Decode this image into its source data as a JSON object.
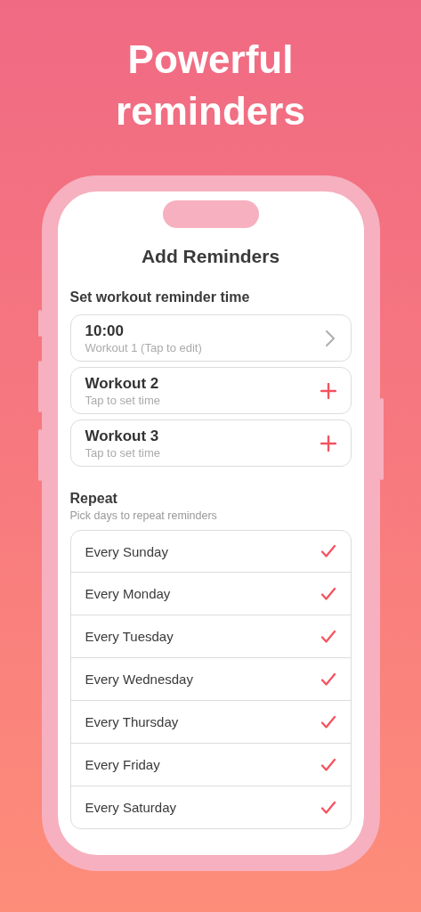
{
  "headline": "Powerful reminders",
  "screen": {
    "title": "Add Reminders",
    "times_section": {
      "label": "Set workout reminder time",
      "items": [
        {
          "kind": "time",
          "title": "10:00",
          "subtitle": "Workout 1 (Tap to edit)"
        },
        {
          "kind": "add",
          "title": "Workout 2",
          "subtitle": "Tap to set time"
        },
        {
          "kind": "add",
          "title": "Workout 3",
          "subtitle": "Tap to set time"
        }
      ]
    },
    "repeat_section": {
      "label": "Repeat",
      "hint": "Pick days to repeat reminders",
      "days": [
        {
          "label": "Every Sunday",
          "checked": true
        },
        {
          "label": "Every Monday",
          "checked": true
        },
        {
          "label": "Every Tuesday",
          "checked": true
        },
        {
          "label": "Every Wednesday",
          "checked": true
        },
        {
          "label": "Every Thursday",
          "checked": true
        },
        {
          "label": "Every Friday",
          "checked": true
        },
        {
          "label": "Every Saturday",
          "checked": true
        }
      ]
    }
  }
}
